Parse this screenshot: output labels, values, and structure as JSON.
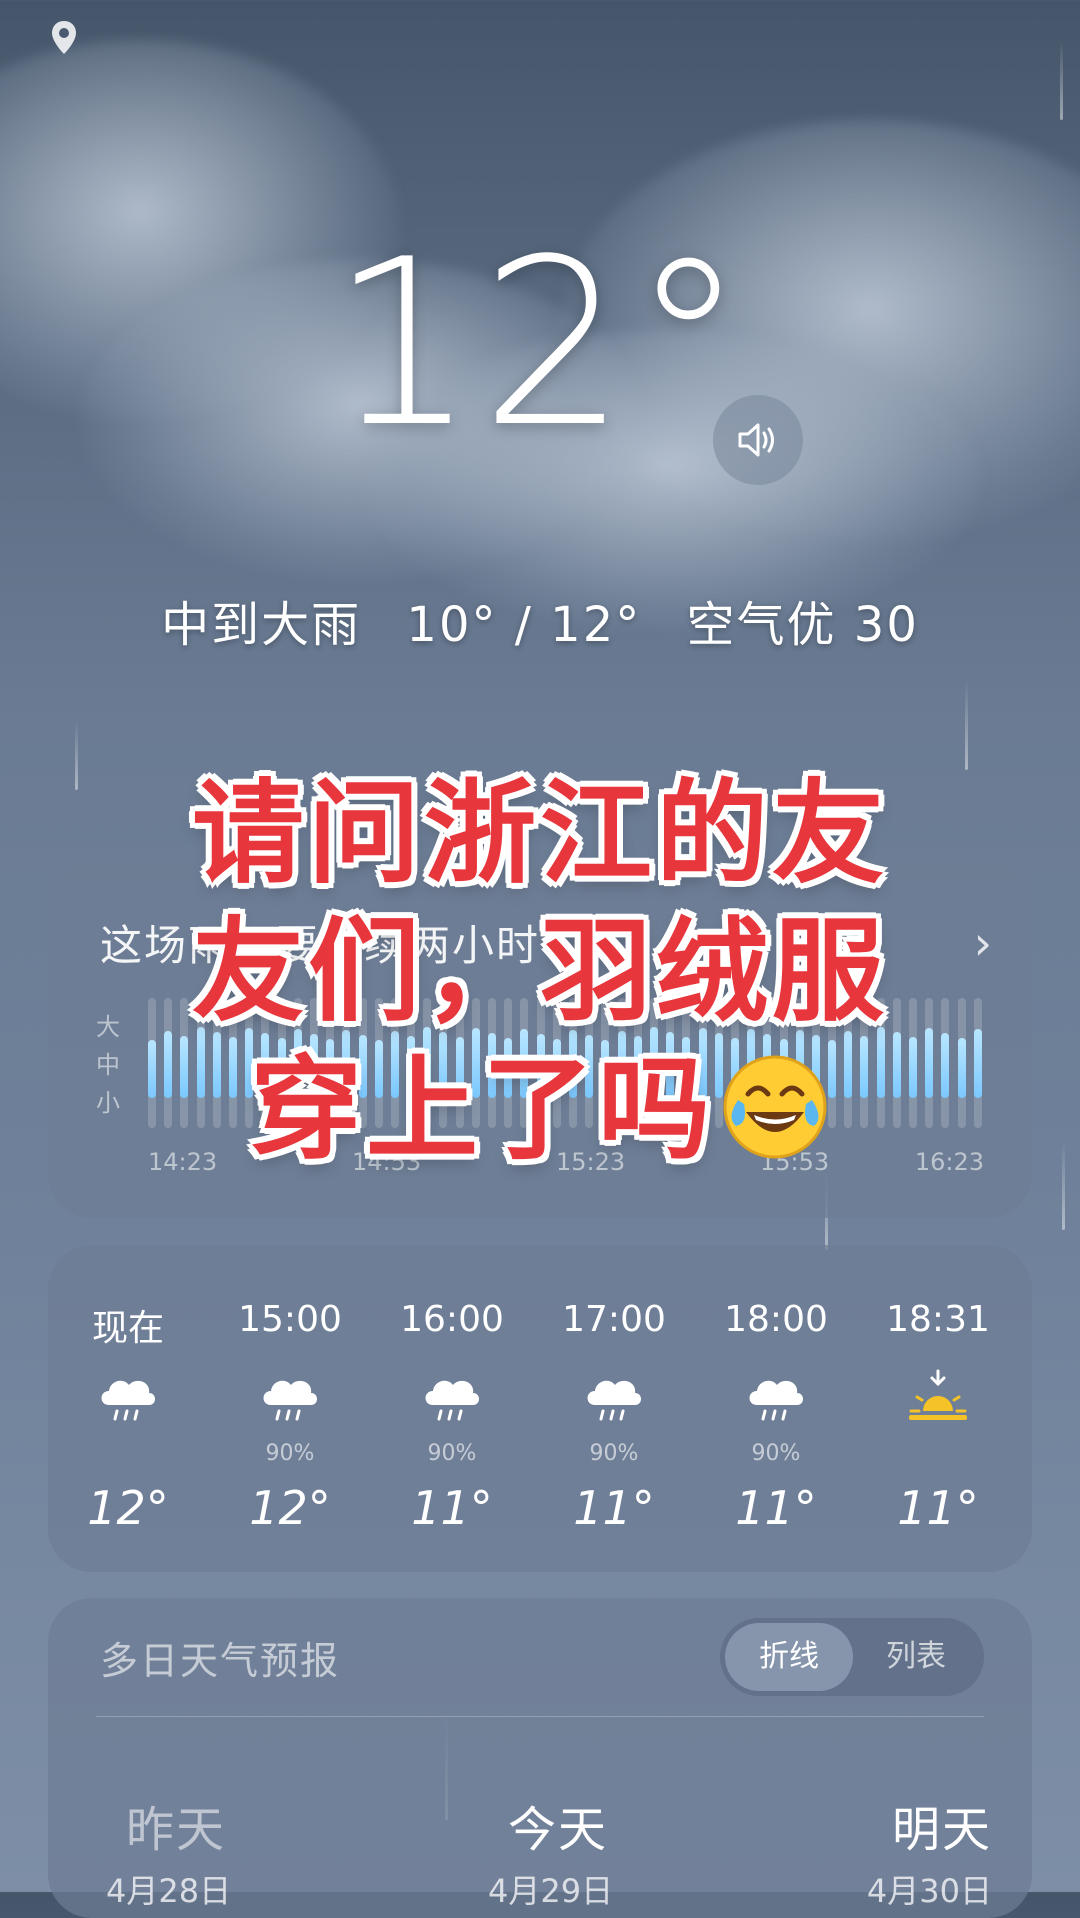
{
  "current": {
    "temperature": "12°",
    "condition": "中到大雨",
    "range": "10° / 12°",
    "air_quality": "空气优 30"
  },
  "rain_forecast": {
    "title": "这场雨还要持续两小时",
    "levels": [
      "大",
      "中",
      "小"
    ],
    "times": [
      "14:23",
      "14:53",
      "15:23",
      "15:53",
      "16:23"
    ]
  },
  "hourly": [
    {
      "time": "现在",
      "icon": "cloud-rain-icon",
      "prob": "",
      "temp": "12°"
    },
    {
      "time": "15:00",
      "icon": "cloud-rain-icon",
      "prob": "90%",
      "temp": "12°"
    },
    {
      "time": "16:00",
      "icon": "cloud-rain-icon",
      "prob": "90%",
      "temp": "11°"
    },
    {
      "time": "17:00",
      "icon": "cloud-rain-icon",
      "prob": "90%",
      "temp": "11°"
    },
    {
      "time": "18:00",
      "icon": "cloud-rain-icon",
      "prob": "90%",
      "temp": "11°"
    },
    {
      "time": "18:31",
      "icon": "sunset-icon",
      "prob": "",
      "temp": "11°"
    }
  ],
  "daily": {
    "title": "多日天气预报",
    "toggle": {
      "active": "折线",
      "inactive": "列表"
    },
    "days": [
      {
        "label": "昨天",
        "date": "4月28日"
      },
      {
        "label": "今天",
        "date": "4月29日"
      },
      {
        "label": "明天",
        "date": "4月30日"
      }
    ]
  },
  "overlay_text": {
    "line1": "请问浙江的友",
    "line2": "友们，羽绒服",
    "line3": "穿上了吗"
  },
  "colors": {
    "overlay_red": "#e8363d",
    "rain_bar": "#7bc8ff",
    "sun": "#f5c327"
  }
}
